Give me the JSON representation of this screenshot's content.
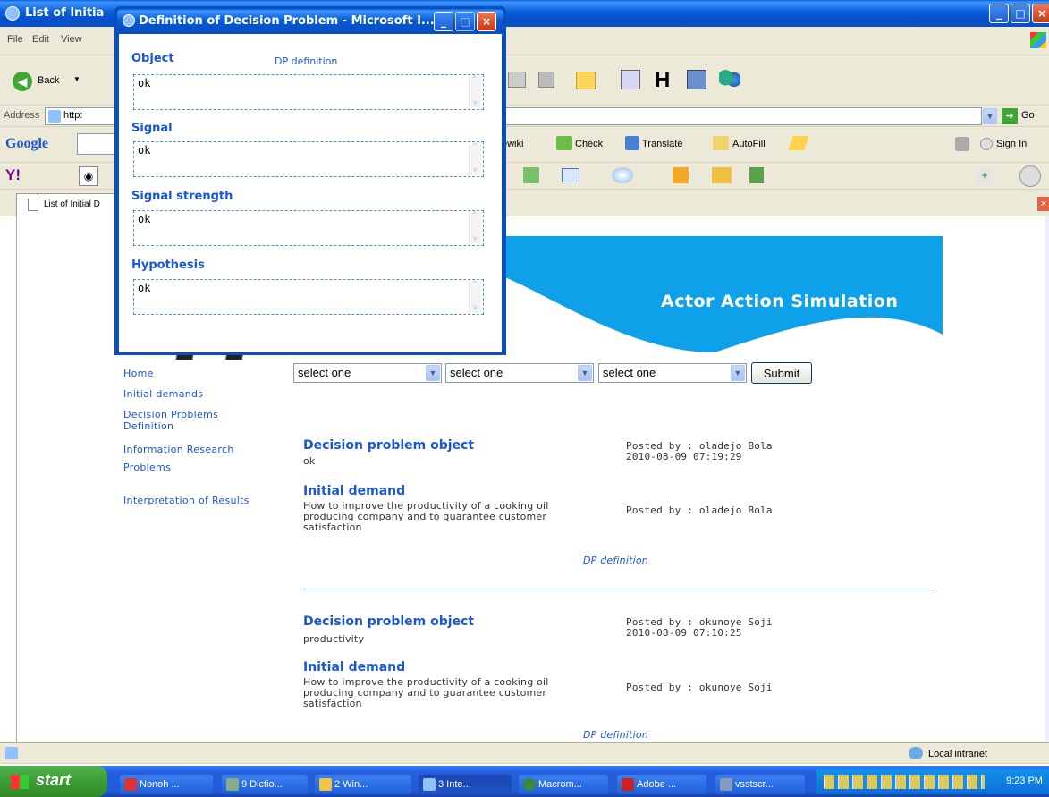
{
  "colors": {
    "xp_blue": "#0a5cd4",
    "link_blue": "#1a56d8",
    "banner": "#0ea0e8",
    "taskbar": "#245edb",
    "start_green": "#3c9d32"
  },
  "browser": {
    "title": "List of Initia",
    "menu": [
      "File",
      "Edit",
      "View"
    ],
    "back_label": "Back",
    "address_label": "Address",
    "address_value": "http:",
    "go_label": "Go",
    "google_label": "Google",
    "google_items": [
      "ewiki",
      "Check",
      "Translate",
      "AutoFill"
    ],
    "sign_in": "Sign In",
    "tab_label": "List of Initial D",
    "status_zone": "Local intranet"
  },
  "popup": {
    "title": "Definition of Decision Problem - Microsoft I...",
    "link": "DP definition",
    "fields": [
      {
        "label": "Object",
        "value": "ok"
      },
      {
        "label": "Signal",
        "value": "ok"
      },
      {
        "label": "Signal strength",
        "value": "ok"
      },
      {
        "label": "Hypothesis",
        "value": "ok"
      }
    ]
  },
  "page": {
    "banner_title": "Actor Action Simulation",
    "nav": [
      "Home",
      "Initial demands",
      "Decision Problems Definition",
      "Information Research Problems",
      "Interpretation of Results"
    ],
    "selects": [
      "select one",
      "select one",
      "select one"
    ],
    "submit": "Submit",
    "posts": [
      {
        "dp_title": "Decision problem object",
        "dp_value": "ok",
        "dp_meta1": "Posted by : oladejo Bola",
        "dp_meta2": "2010-08-09 07:19:29",
        "demand_title": "Initial demand",
        "demand_text": "How to improve the productivity of a cooking oil producing company and to guarantee customer satisfaction",
        "demand_meta": "Posted by : oladejo Bola",
        "link": "DP definition"
      },
      {
        "dp_title": "Decision problem object",
        "dp_value": "productivity",
        "dp_meta1": "Posted by : okunoye Soji",
        "dp_meta2": "2010-08-09 07:10:25",
        "demand_title": "Initial demand",
        "demand_text": "How to improve the productivity of a cooking oil producing company and to guarantee customer satisfaction",
        "demand_meta": "Posted by : okunoye Soji",
        "link": "DP definition"
      }
    ]
  },
  "taskbar": {
    "start": "start",
    "items": [
      "Nonoh ...",
      "9 Dictio...",
      "2 Win...",
      "3 Inte...",
      "Macrom...",
      "Adobe ...",
      "vsstscr..."
    ],
    "clock": "9:23 PM"
  }
}
